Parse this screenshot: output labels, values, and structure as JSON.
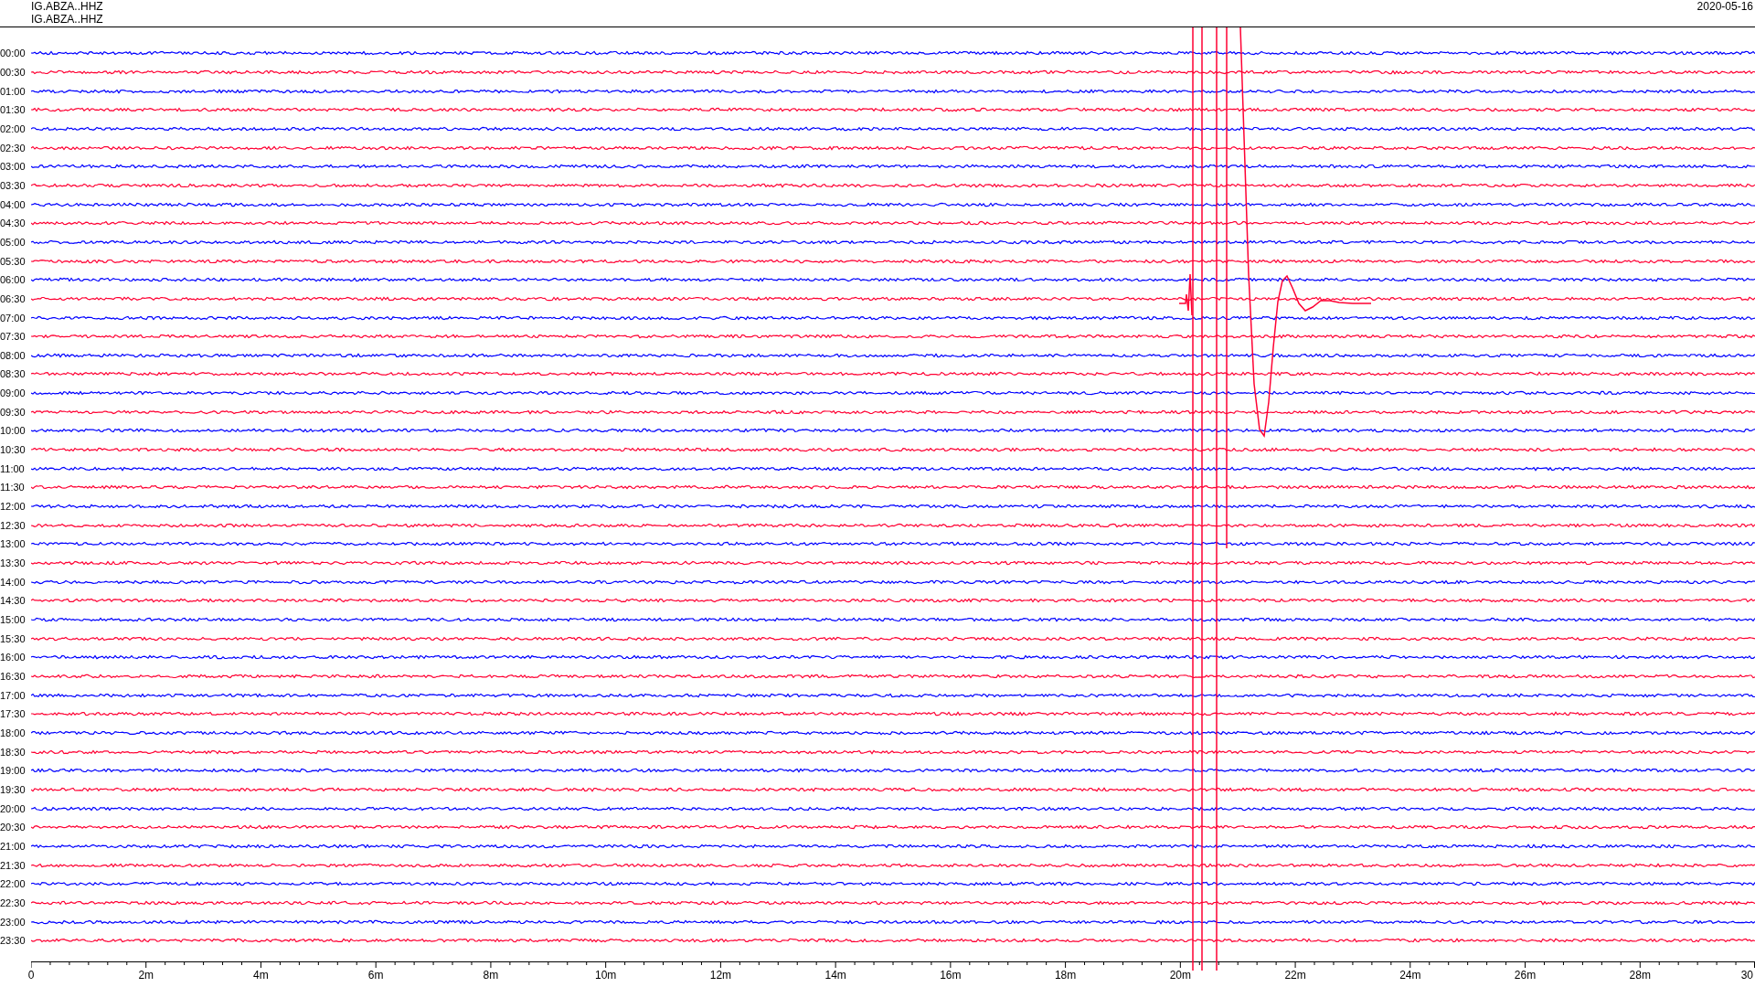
{
  "header": {
    "channels": [
      "IG.ABZA..HHZ",
      "IG.ABZA..HHZ"
    ],
    "date": "2020-05-16"
  },
  "rows": [
    {
      "label": "00:00",
      "color": "#0000ff"
    },
    {
      "label": "00:30",
      "color": "#ff0033"
    },
    {
      "label": "01:00",
      "color": "#0000ff"
    },
    {
      "label": "01:30",
      "color": "#ff0033"
    },
    {
      "label": "02:00",
      "color": "#0000ff"
    },
    {
      "label": "02:30",
      "color": "#ff0033"
    },
    {
      "label": "03:00",
      "color": "#0000ff"
    },
    {
      "label": "03:30",
      "color": "#ff0033"
    },
    {
      "label": "04:00",
      "color": "#0000ff"
    },
    {
      "label": "04:30",
      "color": "#ff0033"
    },
    {
      "label": "05:00",
      "color": "#0000ff"
    },
    {
      "label": "05:30",
      "color": "#ff0033"
    },
    {
      "label": "06:00",
      "color": "#0000ff"
    },
    {
      "label": "06:30",
      "color": "#ff0033"
    },
    {
      "label": "07:00",
      "color": "#0000ff"
    },
    {
      "label": "07:30",
      "color": "#ff0033"
    },
    {
      "label": "08:00",
      "color": "#0000ff"
    },
    {
      "label": "08:30",
      "color": "#ff0033"
    },
    {
      "label": "09:00",
      "color": "#0000ff"
    },
    {
      "label": "09:30",
      "color": "#ff0033"
    },
    {
      "label": "10:00",
      "color": "#0000ff"
    },
    {
      "label": "10:30",
      "color": "#ff0033"
    },
    {
      "label": "11:00",
      "color": "#0000ff"
    },
    {
      "label": "11:30",
      "color": "#ff0033"
    },
    {
      "label": "12:00",
      "color": "#0000ff"
    },
    {
      "label": "12:30",
      "color": "#ff0033"
    },
    {
      "label": "13:00",
      "color": "#0000ff"
    },
    {
      "label": "13:30",
      "color": "#ff0033"
    },
    {
      "label": "14:00",
      "color": "#0000ff"
    },
    {
      "label": "14:30",
      "color": "#ff0033"
    },
    {
      "label": "15:00",
      "color": "#0000ff"
    },
    {
      "label": "15:30",
      "color": "#ff0033"
    },
    {
      "label": "16:00",
      "color": "#0000ff"
    },
    {
      "label": "16:30",
      "color": "#ff0033"
    },
    {
      "label": "17:00",
      "color": "#0000ff"
    },
    {
      "label": "17:30",
      "color": "#ff0033"
    },
    {
      "label": "18:00",
      "color": "#0000ff"
    },
    {
      "label": "18:30",
      "color": "#ff0033"
    },
    {
      "label": "19:00",
      "color": "#0000ff"
    },
    {
      "label": "19:30",
      "color": "#ff0033"
    },
    {
      "label": "20:00",
      "color": "#0000ff"
    },
    {
      "label": "20:30",
      "color": "#ff0033"
    },
    {
      "label": "21:00",
      "color": "#0000ff"
    },
    {
      "label": "21:30",
      "color": "#ff0033"
    },
    {
      "label": "22:00",
      "color": "#0000ff"
    },
    {
      "label": "22:30",
      "color": "#ff0033"
    },
    {
      "label": "23:00",
      "color": "#0000ff"
    },
    {
      "label": "23:30",
      "color": "#ff0033"
    }
  ],
  "axis": {
    "ticks": [
      "0",
      "2m",
      "4m",
      "6m",
      "8m",
      "10m",
      "12m",
      "14m",
      "16m",
      "18m",
      "20m",
      "22m",
      "24m",
      "26m",
      "28m",
      "30"
    ]
  }
}
